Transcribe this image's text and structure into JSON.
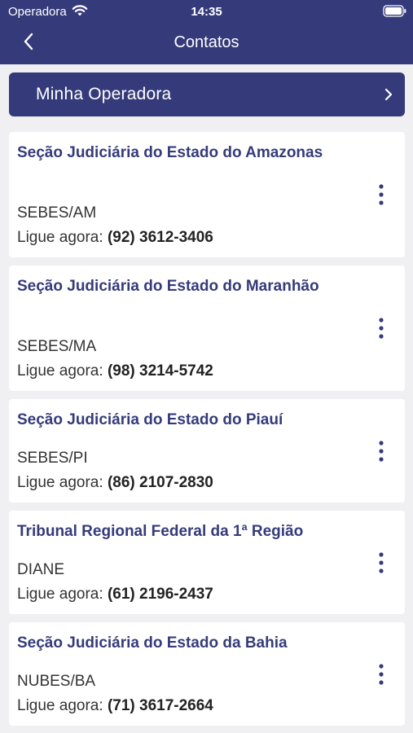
{
  "status_bar": {
    "carrier": "Operadora",
    "time": "14:35",
    "wifi_icon": "wifi-icon",
    "battery_icon": "battery-icon"
  },
  "header": {
    "title": "Contatos",
    "back_icon": "chevron-left-icon"
  },
  "operadora": {
    "label": "Minha Operadora",
    "chevron_icon": "chevron-right-icon"
  },
  "colors": {
    "brand": "#353b7a",
    "background": "#f0f0f2",
    "card": "#ffffff"
  },
  "contacts": [
    {
      "name": "Seção Judiciária do Estado do Amazonas",
      "code": "SEBES/AM",
      "call_label": "Ligue agora:",
      "phone": "(92) 3612-3406"
    },
    {
      "name": "Seção Judiciária do Estado do Maranhão",
      "code": "SEBES/MA",
      "call_label": "Ligue agora:",
      "phone": "(98) 3214-5742"
    },
    {
      "name": "Seção Judiciária do Estado do Piauí",
      "code": "SEBES/PI",
      "call_label": "Ligue agora:",
      "phone": "(86) 2107-2830"
    },
    {
      "name": "Tribunal Regional Federal da 1ª Região",
      "code": "DIANE",
      "call_label": "Ligue agora:",
      "phone": "(61) 2196-2437"
    },
    {
      "name": "Seção Judiciária do Estado da Bahia",
      "code": "NUBES/BA",
      "call_label": "Ligue agora:",
      "phone": "(71) 3617-2664"
    }
  ]
}
